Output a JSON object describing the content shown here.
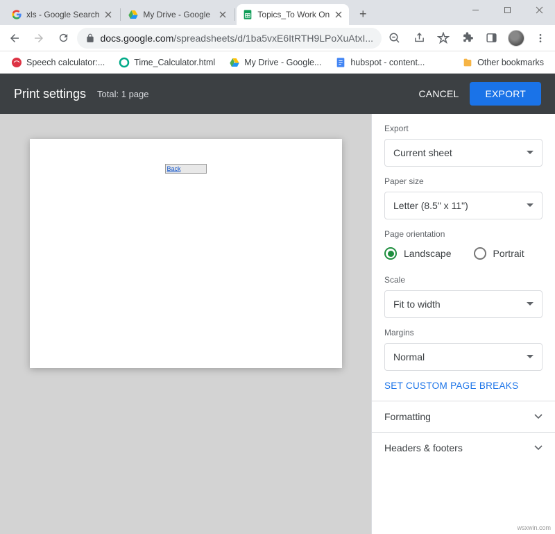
{
  "tabs": [
    {
      "title": "xls - Google Search"
    },
    {
      "title": "My Drive - Google"
    },
    {
      "title": "Topics_To Work On"
    }
  ],
  "url": {
    "host": "docs.google.com",
    "path": "/spreadsheets/d/1ba5vxE6ItRTH9LPoXuAtxI..."
  },
  "bookmarks": [
    {
      "label": "Speech calculator:..."
    },
    {
      "label": "Time_Calculator.html"
    },
    {
      "label": "My Drive - Google..."
    },
    {
      "label": "hubspot - content..."
    }
  ],
  "other_bookmarks": "Other bookmarks",
  "header": {
    "title": "Print settings",
    "subtitle": "Total: 1 page",
    "cancel": "CANCEL",
    "export": "EXPORT"
  },
  "preview_cell": "Back",
  "sidebar": {
    "export_label": "Export",
    "export_value": "Current sheet",
    "paper_label": "Paper size",
    "paper_value": "Letter (8.5\" x 11\")",
    "orient_label": "Page orientation",
    "orient_landscape": "Landscape",
    "orient_portrait": "Portrait",
    "scale_label": "Scale",
    "scale_value": "Fit to width",
    "margins_label": "Margins",
    "margins_value": "Normal",
    "page_breaks": "SET CUSTOM PAGE BREAKS",
    "formatting": "Formatting",
    "headers": "Headers & footers"
  },
  "watermark": "wsxwin.com"
}
